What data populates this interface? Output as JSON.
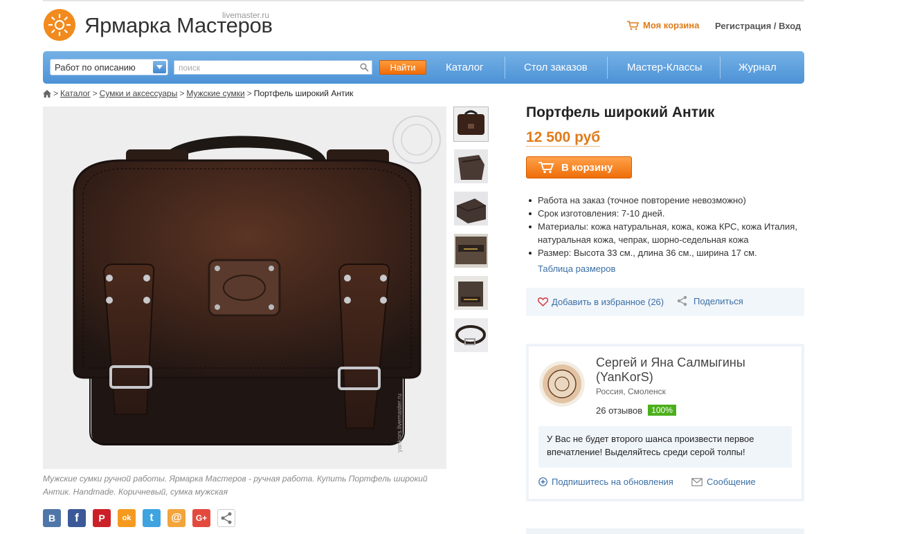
{
  "header": {
    "logo_title": "Ярмарка Мастеров",
    "logo_domain": "livemaster.ru",
    "cart_label": "Моя корзина",
    "auth_label": "Регистрация / Вход"
  },
  "nav": {
    "search_mode": "Работ по описанию",
    "search_placeholder": "поиск",
    "find_label": "Найти",
    "items": [
      "Каталог",
      "Стол заказов",
      "Мастер-Классы",
      "Журнал"
    ]
  },
  "breadcrumb": {
    "items": [
      "Каталог",
      "Сумки и аксессуары",
      "Мужские сумки"
    ],
    "current": "Портфель широкий Антик"
  },
  "product": {
    "title": "Портфель широкий Антик",
    "price": "12 500 руб",
    "buy_label": "В корзину",
    "image_caption": "Мужские сумки ручной работы. Ярмарка Мастеров - ручная работа. Купить Портфель широкий Антик. Handmade. Коричневый, сумка мужская",
    "image_watermark": "yankors.livemaster.ru",
    "features": [
      "Работа на заказ  (точное повторение невозможно)",
      "Срок изготовления: 7-10 дней.",
      "Материалы: кожа натуральная, кожа, кожа КРС, кожа Италия, натуральная кожа, чепрак, шорно-седельная кожа",
      "Размер: Высота 33 см., длина 36 см., ширина 17 см."
    ],
    "size_table_link": "Таблица размеров",
    "favorite_label": "Добавить в избранное (26)",
    "share_label": "Поделиться"
  },
  "social": [
    {
      "name": "vk-icon",
      "glyph": "В",
      "color": "#4f76a8"
    },
    {
      "name": "facebook-icon",
      "glyph": "f",
      "color": "#3b5998"
    },
    {
      "name": "pinterest-icon",
      "glyph": "P",
      "color": "#cb2027"
    },
    {
      "name": "odnoklassniki-icon",
      "glyph": "ok",
      "color": "#f59a1f"
    },
    {
      "name": "twitter-icon",
      "glyph": "t",
      "color": "#3fa3e0"
    },
    {
      "name": "mailru-icon",
      "glyph": "@",
      "color": "#f3a43b"
    },
    {
      "name": "googleplus-icon",
      "glyph": "G+",
      "color": "#e34a3d"
    },
    {
      "name": "share-more-icon",
      "glyph": "",
      "color": "#ffffff"
    }
  ],
  "shop": {
    "name": "Сергей и Яна Салмыгины (YanKorS)",
    "location": "Россия, Смоленск",
    "reviews": "26 отзывов",
    "rating": "100%",
    "quote": "У Вас не будет второго шанса произвести первое впечатление! Выделяйтесь среди серой толпы!",
    "subscribe_label": "Подпишитесь на обновления",
    "message_label": "Сообщение"
  },
  "colors": {
    "accent_orange": "#e07b1a",
    "nav_blue": "#4d92d6",
    "link_blue": "#3a6ea5",
    "rating_green": "#4caf1c"
  }
}
